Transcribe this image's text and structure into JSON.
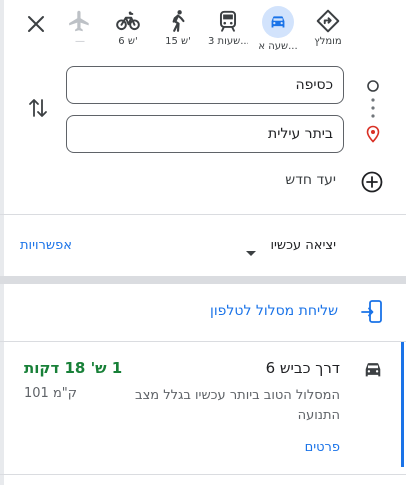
{
  "colors": {
    "accent": "#1a73e8",
    "selected_mode_bg": "#d2e3fc",
    "duration_green": "#188038"
  },
  "modes": [
    {
      "icon": "directions-icon",
      "label": "מומלץ"
    },
    {
      "icon": "car-icon",
      "label": "שעה א...",
      "selected": true
    },
    {
      "icon": "transit-icon",
      "label": "3 שעות..."
    },
    {
      "icon": "walk-icon",
      "label": "15 ש'"
    },
    {
      "icon": "bike-icon",
      "label": "6 ש'"
    },
    {
      "icon": "flight-icon",
      "label": "—"
    }
  ],
  "origin": {
    "value": "כסיפה"
  },
  "destination": {
    "value": "ביתר עילית"
  },
  "add_destination_label": "יעד חדש",
  "depart": {
    "label": "יציאה עכשיו"
  },
  "options_label": "אפשרויות",
  "send_to_phone_label": "שליחת מסלול לטלפון",
  "route": {
    "title": "דרך כביש 6",
    "duration": "1 ש' 18 דקות",
    "distance": "101 ק\"מ",
    "description": "המסלול הטוב ביותר עכשיו בגלל מצב התנועה",
    "details_label": "פרטים"
  }
}
